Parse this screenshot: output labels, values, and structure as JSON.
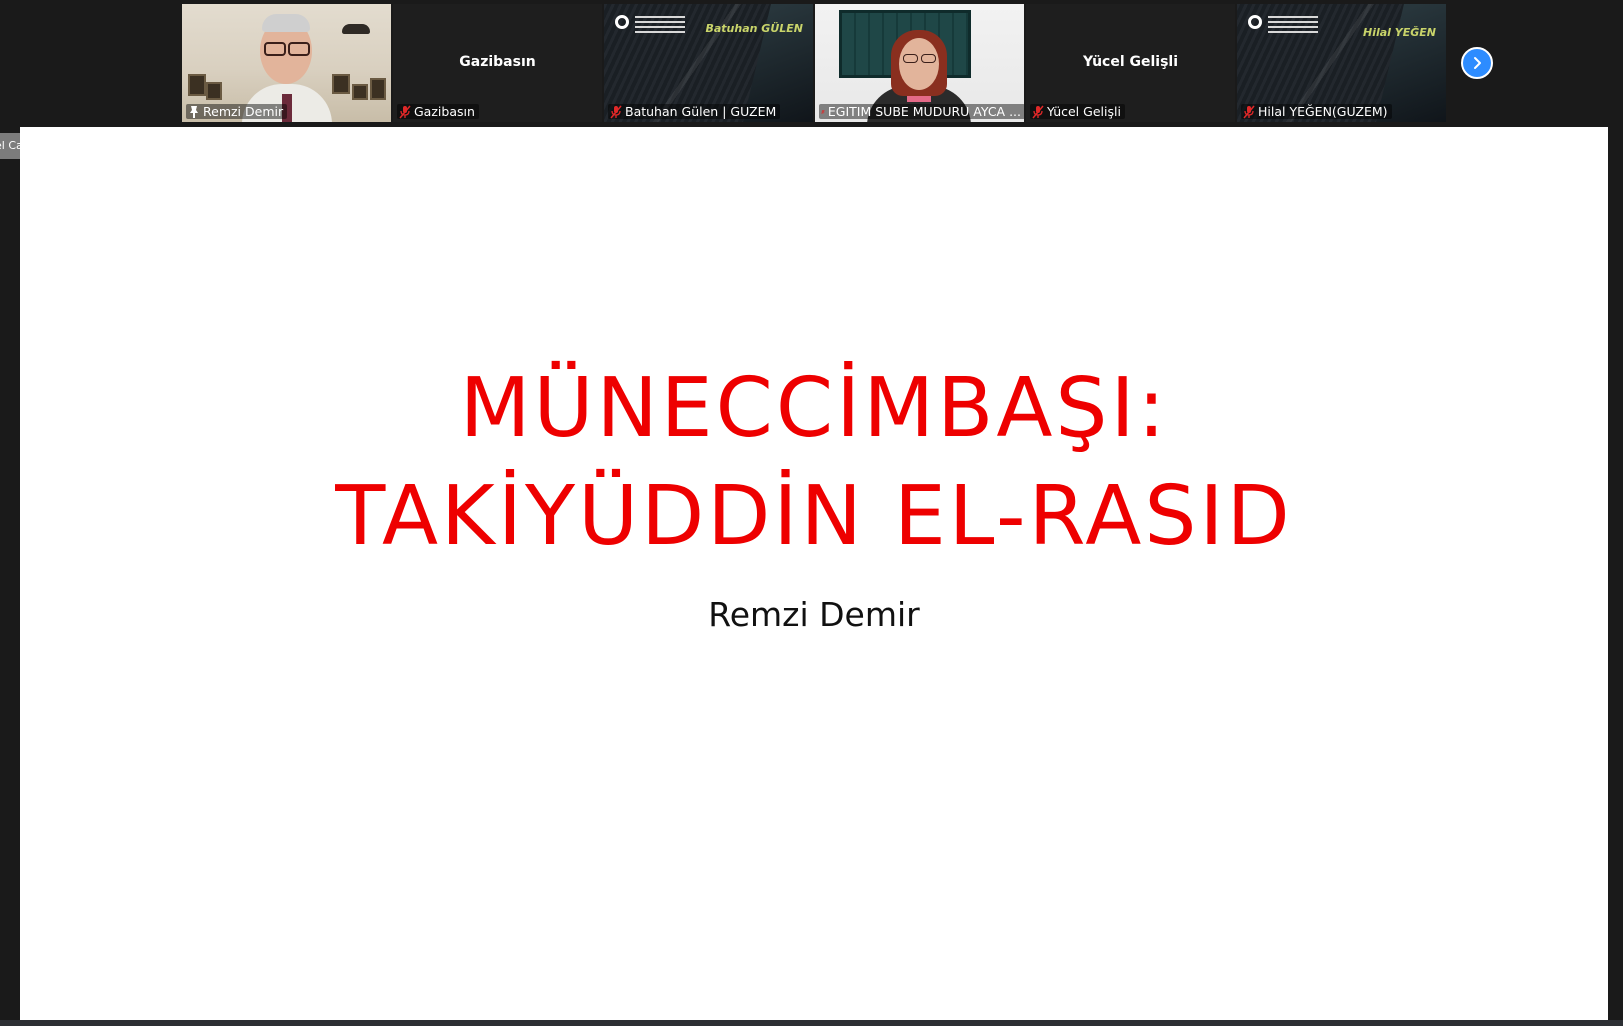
{
  "participants": [
    {
      "name": "Remzi Demir",
      "video": "camera",
      "status": "pinned-icon"
    },
    {
      "name": "Gazibasın",
      "display_name": "Gazibasın",
      "video": "off",
      "status": "muted-icon"
    },
    {
      "name": "Batuhan Gülen | GUZEM",
      "card_name": "Batuhan GÜLEN",
      "video": "card",
      "status": "muted-icon"
    },
    {
      "name": "EGITIM SUBE MUDURU AYCA ...",
      "video": "camera",
      "status": "muted-icon"
    },
    {
      "name": "Yücel Gelişli",
      "display_name": "Yücel Gelişli",
      "video": "off",
      "status": "muted-icon"
    },
    {
      "name": "Hilal YEĞEN(GUZEM)",
      "card_name": "Hilal YEĞEN",
      "video": "card",
      "status": "muted-icon"
    }
  ],
  "next_page_icon": "chevron-right-icon",
  "view_menu": {
    "label": "el Canlı Yayın Hizmeti",
    "icon": "caret-down-icon"
  },
  "slide": {
    "title_line1": "MÜNECCİMBAŞI:",
    "title_line2": "TAKİYÜDDİN EL-RASID",
    "author": "Remzi Demir"
  },
  "colors": {
    "accent_blue": "#2d8cff",
    "title_red": "#ee0000",
    "active_speaker_border": "#b5cf6b",
    "mute_red": "#e02828"
  }
}
